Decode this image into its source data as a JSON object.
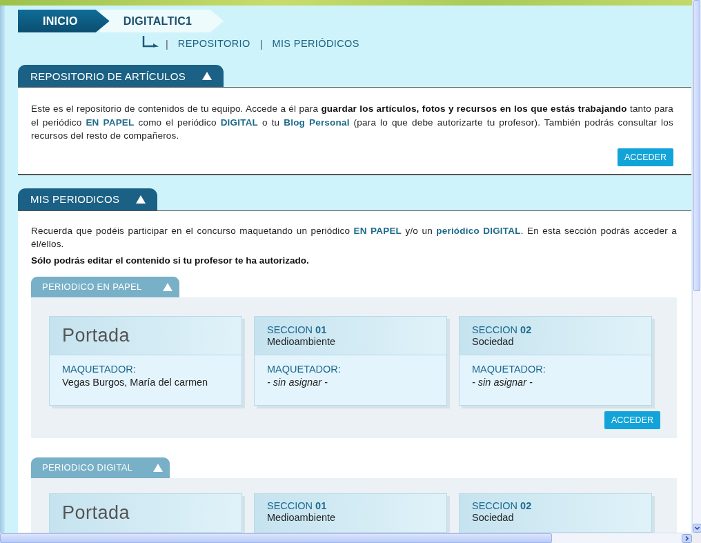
{
  "breadcrumb": [
    {
      "label": "INICIO",
      "selected": false
    },
    {
      "label": "DIGITALTIC1",
      "selected": true
    }
  ],
  "subnav": [
    {
      "separator": "|",
      "label": "REPOSITORIO"
    },
    {
      "separator": "|",
      "label": "MIS PERIÓDICOS"
    }
  ],
  "repository": {
    "title": "REPOSITORIO DE ARTÍCULOS",
    "expanded": true,
    "paragraph": [
      {
        "kind": "plain",
        "text": "Este es el repositorio de contenidos de tu equipo. Accede a él para "
      },
      {
        "kind": "bold",
        "text": "guardar los artículos, fotos y recursos en los que estás trabajando"
      },
      {
        "kind": "plain",
        "text": " tanto para el periódico "
      },
      {
        "kind": "accent",
        "text": "EN PAPEL"
      },
      {
        "kind": "plain",
        "text": " como el periódico "
      },
      {
        "kind": "accent",
        "text": "DIGITAL"
      },
      {
        "kind": "plain",
        "text": " o tu "
      },
      {
        "kind": "accent",
        "text": "Blog Personal"
      },
      {
        "kind": "plain",
        "text": " (para lo que debe autorizarte tu profesor). También podrás consultar los recursos del resto de compañeros."
      }
    ],
    "button": "ACCEDER"
  },
  "newspapers_section": {
    "title": "MIS PERIODICOS",
    "expanded": true,
    "paragraph": [
      {
        "kind": "plain",
        "text": "Recuerda que podéis participar en el concurso maquetando un periódico "
      },
      {
        "kind": "accent",
        "text": "EN PAPEL"
      },
      {
        "kind": "plain",
        "text": " y/o un "
      },
      {
        "kind": "accent",
        "text": "periódico DIGITAL"
      },
      {
        "kind": "plain",
        "text": ". En esta sección podrás acceder a él/ellos."
      }
    ],
    "note": "Sólo podrás editar el contenido si tu profesor te ha autorizado.",
    "newspapers": [
      {
        "title": "PERIODICO EN PAPEL",
        "expanded": true,
        "button": "ACCEDER",
        "pages": [
          {
            "kind": "cover",
            "title": "Portada",
            "label": "MAQUETADOR:",
            "value": "Vegas Burgos, María del carmen",
            "assigned": true
          },
          {
            "kind": "section",
            "title": "SECCION **01**",
            "subtitle": "Medioambiente",
            "label": "MAQUETADOR:",
            "value": "- sin asignar -",
            "assigned": false
          },
          {
            "kind": "section",
            "title": "SECCION **02**",
            "subtitle": "Sociedad",
            "label": "MAQUETADOR:",
            "value": "- sin asignar -",
            "assigned": false
          }
        ]
      },
      {
        "title": "PERIODICO DIGITAL",
        "expanded": true,
        "pages": [
          {
            "kind": "cover",
            "title": "Portada"
          },
          {
            "kind": "section",
            "title": "SECCION **01**",
            "subtitle": "Medioambiente"
          },
          {
            "kind": "section",
            "title": "SECCION **02**",
            "subtitle": "Sociedad"
          }
        ]
      }
    ]
  }
}
